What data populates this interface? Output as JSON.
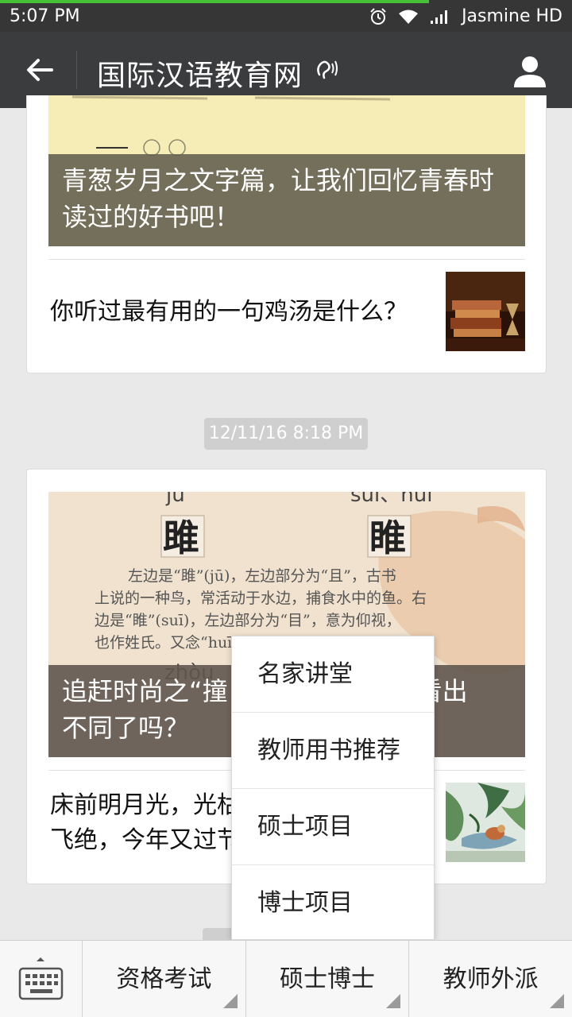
{
  "status_bar": {
    "time": "5:07 PM",
    "carrier": "Jasmine HD"
  },
  "header": {
    "title": "国际汉语教育网"
  },
  "feed": {
    "card1": {
      "cover_caption": "青葱岁月之文字篇，让我们回忆青春时读过的好书吧！",
      "sub_title": "你听过最有用的一句鸡汤是什么？"
    },
    "timestamp": "12/11/16 8:18 PM",
    "card2": {
      "cover_caption": "追赶时尚之“撞                              看出不同了吗？",
      "caption_line1_left": "追赶时尚之“撞",
      "caption_line1_right": "看出",
      "caption_line2": "不同了吗？",
      "sub_title_line1": "床前明月光，光枯",
      "sub_title_line2": "飞绝，今年又过节"
    }
  },
  "popup_menu": {
    "items": [
      "名家讲堂",
      "教师用书推荐",
      "硕士项目",
      "博士项目"
    ]
  },
  "bottom_menu": {
    "items": [
      "资格考试",
      "硕士博士",
      "教师外派"
    ]
  }
}
